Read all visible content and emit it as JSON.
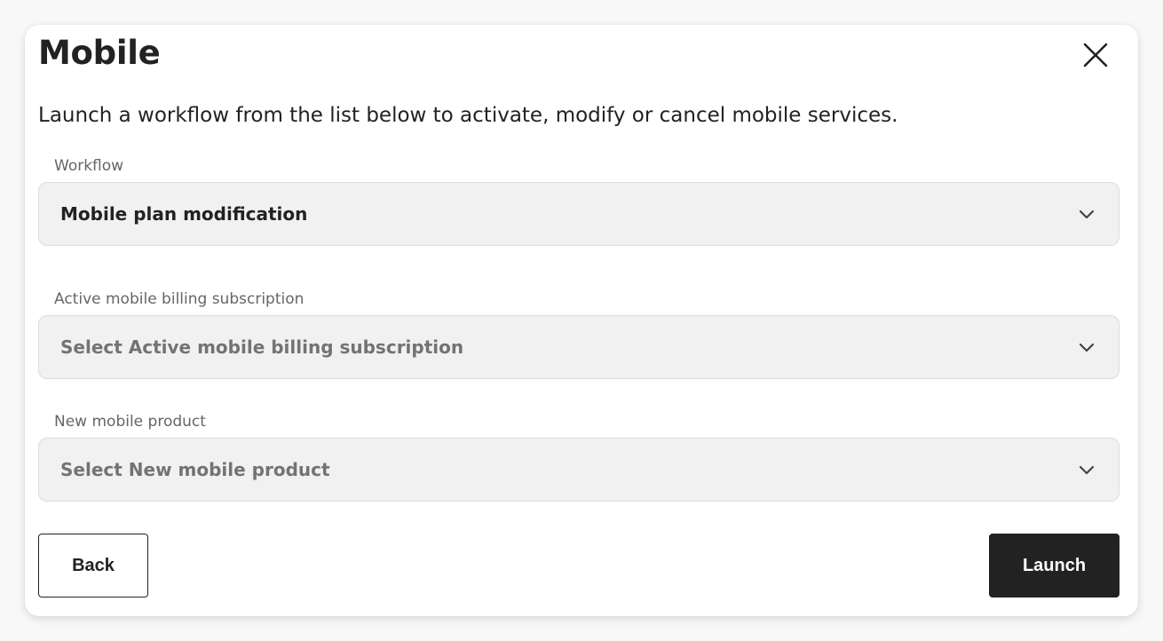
{
  "modal": {
    "title": "Mobile",
    "description": "Launch a workflow from the list below to activate, modify or cancel mobile services.",
    "close_icon": "close-icon"
  },
  "fields": [
    {
      "label": "Workflow",
      "value": "Mobile plan modification",
      "is_placeholder": false
    },
    {
      "label": "Active mobile billing subscription",
      "value": "Select Active mobile billing subscription",
      "is_placeholder": true
    },
    {
      "label": "New mobile product",
      "value": "Select New mobile product",
      "is_placeholder": true
    }
  ],
  "actions": {
    "back_label": "Back",
    "launch_label": "Launch"
  },
  "colors": {
    "primary_button": "#222222",
    "select_background": "#f1f1f1",
    "placeholder_text": "#737373",
    "label_text": "#666666"
  }
}
